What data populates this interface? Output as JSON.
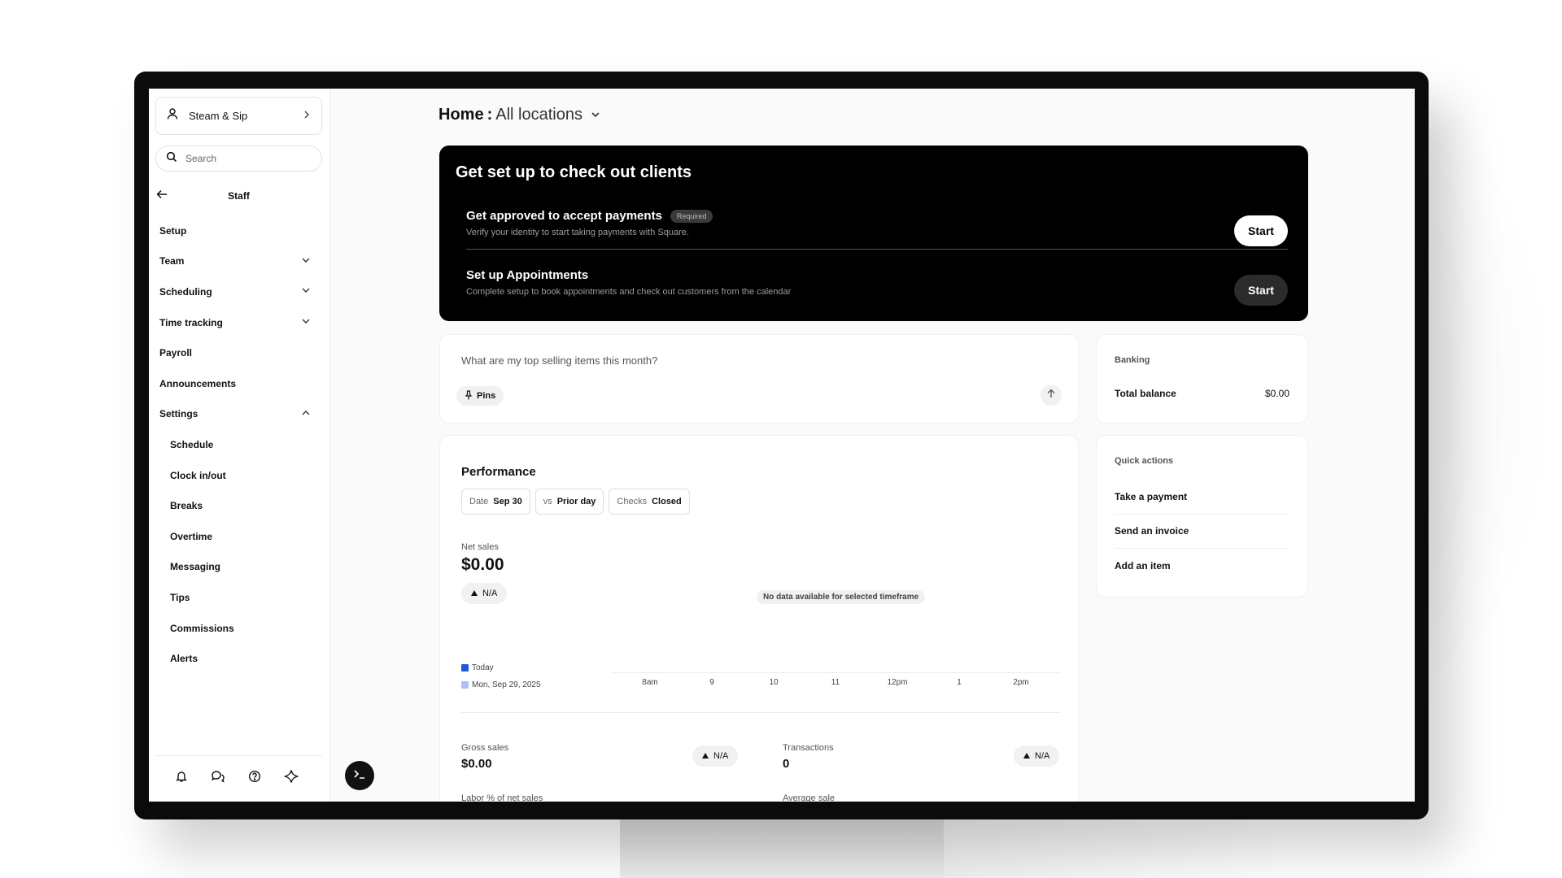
{
  "sidebar": {
    "business_name": "Steam & Sip",
    "search_placeholder": "Search",
    "section_title": "Staff",
    "items": [
      {
        "label": "Setup",
        "chevron": "none",
        "sub": false
      },
      {
        "label": "Team",
        "chevron": "down",
        "sub": false
      },
      {
        "label": "Scheduling",
        "chevron": "down",
        "sub": false
      },
      {
        "label": "Time tracking",
        "chevron": "down",
        "sub": false
      },
      {
        "label": "Payroll",
        "chevron": "none",
        "sub": false
      },
      {
        "label": "Announcements",
        "chevron": "none",
        "sub": false
      },
      {
        "label": "Settings",
        "chevron": "up",
        "sub": false
      },
      {
        "label": "Schedule",
        "chevron": "none",
        "sub": true
      },
      {
        "label": "Clock in/out",
        "chevron": "none",
        "sub": true
      },
      {
        "label": "Breaks",
        "chevron": "none",
        "sub": true
      },
      {
        "label": "Overtime",
        "chevron": "none",
        "sub": true
      },
      {
        "label": "Messaging",
        "chevron": "none",
        "sub": true
      },
      {
        "label": "Tips",
        "chevron": "none",
        "sub": true
      },
      {
        "label": "Commissions",
        "chevron": "none",
        "sub": true
      },
      {
        "label": "Alerts",
        "chevron": "none",
        "sub": true
      }
    ],
    "footer_icons": [
      "bell-icon",
      "chat-icon",
      "help-icon",
      "sparkle-icon"
    ]
  },
  "header": {
    "home": "Home",
    "separator": ":",
    "location": "All locations"
  },
  "setup": {
    "title": "Get set up to check out clients",
    "tasks": [
      {
        "title": "Get approved to accept payments",
        "badge": "Required",
        "description": "Verify your identity to start taking payments with Square.",
        "button": "Start"
      },
      {
        "title": "Set up Appointments",
        "badge": "",
        "description": "Complete setup to book appointments and check out customers from the calendar",
        "button": "Start"
      }
    ]
  },
  "assistant": {
    "question": "What are my top selling items this month?",
    "pins_label": "Pins"
  },
  "banking": {
    "label": "Banking",
    "total_label": "Total balance",
    "total_value": "$0.00"
  },
  "quick_actions": {
    "label": "Quick actions",
    "items": [
      "Take a payment",
      "Send an invoice",
      "Add an item"
    ]
  },
  "performance": {
    "title": "Performance",
    "filters": [
      {
        "key": "Date",
        "value": "Sep 30"
      },
      {
        "key": "vs",
        "value": "Prior day"
      },
      {
        "key": "Checks",
        "value": "Closed"
      }
    ],
    "net_sales_label": "Net sales",
    "net_sales_value": "$0.00",
    "net_sales_change": "N/A",
    "no_data": "No data available for selected timeframe",
    "legend": [
      {
        "label": "Today",
        "color": "#1f5bd6"
      },
      {
        "label": "Mon, Sep 29, 2025",
        "color": "#a9c4ee"
      }
    ],
    "x_ticks": [
      "8am",
      "9",
      "10",
      "11",
      "12pm",
      "1",
      "2pm"
    ],
    "gross_sales_label": "Gross sales",
    "gross_sales_value": "$0.00",
    "gross_sales_change": "N/A",
    "transactions_label": "Transactions",
    "transactions_value": "0",
    "transactions_change": "N/A",
    "labor_label": "Labor % of net sales",
    "average_sale_label": "Average sale"
  }
}
